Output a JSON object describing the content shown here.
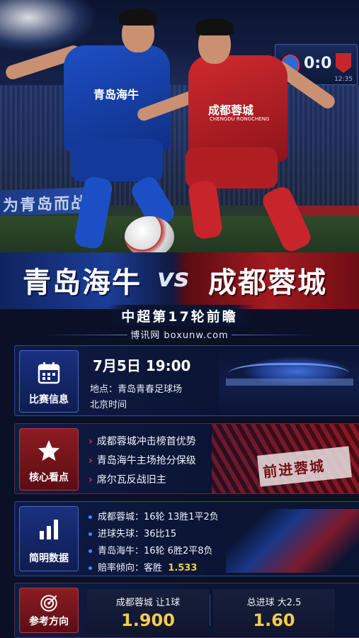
{
  "scoreboard": {
    "score": "0:0",
    "time": "12:35"
  },
  "hero": {
    "blue_jersey": "青岛海牛",
    "red_jersey": "成都蓉城",
    "red_jersey_sub": "CHENGDU RONGCHENG",
    "stand_banner": "为青岛而战"
  },
  "title": {
    "home": "青岛海牛",
    "vs": "vs",
    "away": "成都蓉城",
    "subtitle": "中超第17轮前瞻",
    "site": "博讯网 boxunw.com"
  },
  "match_info": {
    "label": "比赛信息",
    "date_time": "7月5日 19:00",
    "venue": "地点：青岛青春足球场",
    "timezone": "北京时间"
  },
  "highlights": {
    "label": "核心看点",
    "items": [
      "成都蓉城冲击榜首优势",
      "青岛海牛主场抢分保级",
      "席尔瓦反战旧主"
    ],
    "fan_banner": "前进蓉城"
  },
  "stats": {
    "label": "简明数据",
    "items": [
      {
        "text": "成都蓉城：16轮 13胜1平2负",
        "highlight": ""
      },
      {
        "text": "进球失球：36比15",
        "highlight": ""
      },
      {
        "text": "青岛海牛：16轮 6胜2平8负",
        "highlight": ""
      },
      {
        "text": "赔率倾向：客胜",
        "highlight": "1.533"
      }
    ]
  },
  "reference": {
    "label": "参考方向",
    "picks": [
      {
        "name": "成都蓉城 让1球",
        "odds": "1.900"
      },
      {
        "name": "总进球 大2.5",
        "odds": "1.60"
      }
    ]
  },
  "colors": {
    "accent_gold": "#f3cc4a",
    "blue": "#1d4fc4",
    "red": "#c8242c"
  }
}
